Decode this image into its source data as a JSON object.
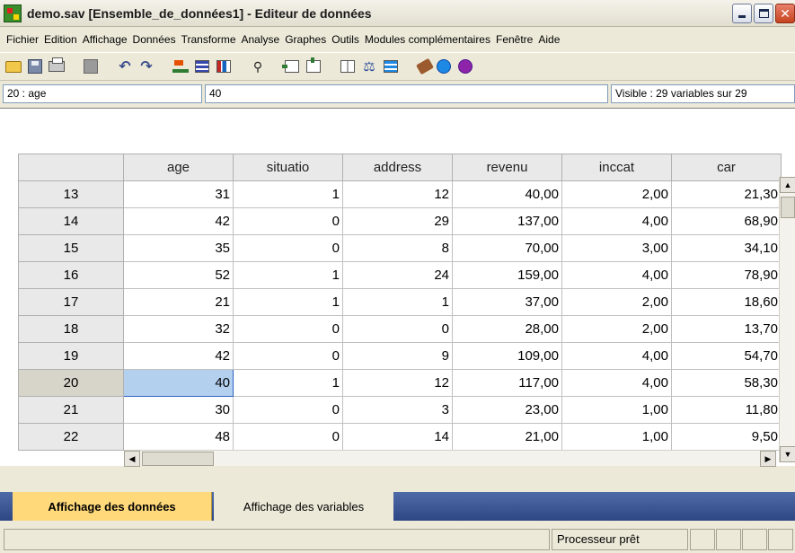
{
  "window": {
    "title": "demo.sav [Ensemble_de_données1] - Editeur de données"
  },
  "menu": [
    "Fichier",
    "Edition",
    "Affichage",
    "Données",
    "Transforme",
    "Analyse",
    "Graphes",
    "Outils",
    "Modules complémentaires",
    "Fenêtre",
    "Aide"
  ],
  "toolbar": {
    "icons": [
      "open-folder-icon",
      "save-disk-icon",
      "print-icon",
      "dialog-recall-icon",
      "undo-icon",
      "redo-icon",
      "goto-case-icon",
      "variables-icon",
      "find-icon",
      "insert-case-icon",
      "insert-variable-icon",
      "split-file-icon",
      "weight-cases-icon",
      "select-cases-icon",
      "value-labels-icon",
      "use-sets-icon",
      "show-all-icon"
    ]
  },
  "cellbar": {
    "ref": "20 : age",
    "value": "40",
    "visible": "Visible : 29 variables sur 29"
  },
  "grid": {
    "columns": [
      "age",
      "situatio",
      "address",
      "revenu",
      "inccat",
      "car"
    ],
    "rows": [
      {
        "n": "13",
        "cells": [
          "31",
          "1",
          "12",
          "40,00",
          "2,00",
          "21,30"
        ]
      },
      {
        "n": "14",
        "cells": [
          "42",
          "0",
          "29",
          "137,00",
          "4,00",
          "68,90"
        ]
      },
      {
        "n": "15",
        "cells": [
          "35",
          "0",
          "8",
          "70,00",
          "3,00",
          "34,10"
        ]
      },
      {
        "n": "16",
        "cells": [
          "52",
          "1",
          "24",
          "159,00",
          "4,00",
          "78,90"
        ]
      },
      {
        "n": "17",
        "cells": [
          "21",
          "1",
          "1",
          "37,00",
          "2,00",
          "18,60"
        ]
      },
      {
        "n": "18",
        "cells": [
          "32",
          "0",
          "0",
          "28,00",
          "2,00",
          "13,70"
        ]
      },
      {
        "n": "19",
        "cells": [
          "42",
          "0",
          "9",
          "109,00",
          "4,00",
          "54,70"
        ]
      },
      {
        "n": "20",
        "cells": [
          "40",
          "1",
          "12",
          "117,00",
          "4,00",
          "58,30"
        ]
      },
      {
        "n": "21",
        "cells": [
          "30",
          "0",
          "3",
          "23,00",
          "1,00",
          "11,80"
        ]
      },
      {
        "n": "22",
        "cells": [
          "48",
          "0",
          "14",
          "21,00",
          "1,00",
          "9,50"
        ]
      }
    ],
    "selected_row": "20",
    "selected_column": "age"
  },
  "tabs": {
    "data_view": "Affichage des données",
    "variable_view": "Affichage des variables"
  },
  "status": {
    "processor": "Processeur prêt"
  }
}
